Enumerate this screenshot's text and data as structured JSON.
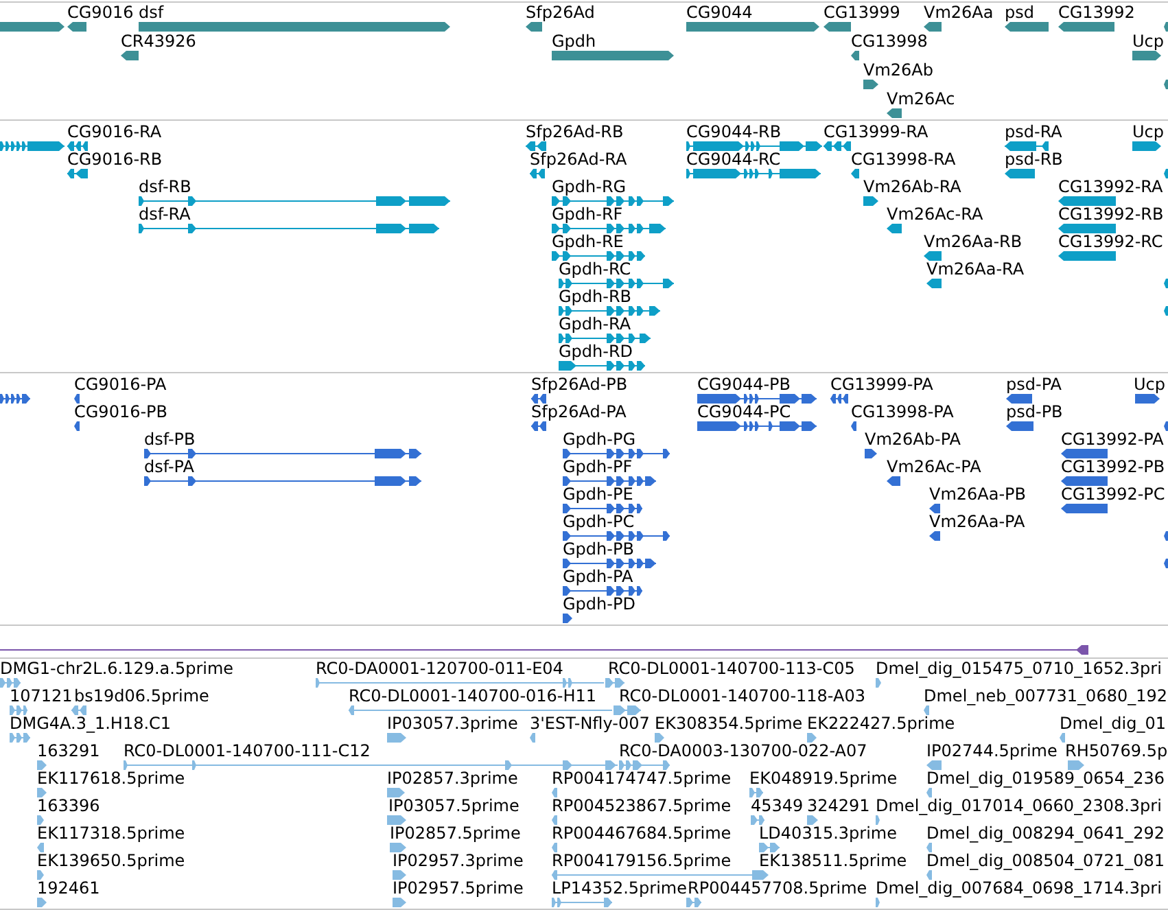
{
  "tracks": [
    {
      "color": "#3d9096",
      "rows": [
        {
          "features": [
            {
              "reverse": false
            },
            {
              "label": "CG9016",
              "reverse": true
            },
            {
              "label": "dsf",
              "reverse": false
            },
            {
              "label": "Sfp26Ad",
              "reverse": true
            },
            {
              "label": "CG9044",
              "reverse": false
            },
            {
              "label": "CG13999",
              "reverse": true
            },
            {
              "label": "Vm26Aa",
              "reverse": true
            },
            {
              "label": "psd",
              "reverse": true
            },
            {
              "label": "CG13992",
              "reverse": true
            },
            {
              "reverse": true
            }
          ]
        },
        {
          "features": [
            {
              "label": "CR43926",
              "reverse": true
            },
            {
              "label": "Gpdh",
              "reverse": false
            },
            {
              "label": "CG13998",
              "reverse": true
            },
            {
              "label": "Ucp",
              "reverse": false
            }
          ]
        },
        {
          "features": [
            {
              "label": "Vm26Ab",
              "reverse": false
            },
            {
              "reverse": true
            }
          ]
        },
        {
          "features": [
            {
              "label": "Vm26Ac",
              "reverse": true
            }
          ]
        }
      ]
    },
    {
      "color": "#0e9fc7",
      "rows": [
        {
          "features": [
            {
              "reverse": false
            },
            {
              "label": "CG9016-RA",
              "reverse": true
            },
            {
              "label": "Sfp26Ad-RB",
              "reverse": true
            },
            {
              "label": "CG9044-RB",
              "reverse": false
            },
            {
              "label": "CG13999-RA",
              "reverse": true
            },
            {
              "label": "psd-RA",
              "reverse": true
            },
            {
              "label": "Ucp",
              "reverse": false
            }
          ]
        },
        {
          "features": [
            {
              "label": "CG9016-RB",
              "reverse": true
            },
            {
              "label": "Sfp26Ad-RA",
              "reverse": true
            },
            {
              "label": "CG9044-RC",
              "reverse": false
            },
            {
              "label": "CG13998-RA",
              "reverse": true
            },
            {
              "label": "psd-RB",
              "reverse": true
            },
            {
              "reverse": true
            }
          ]
        },
        {
          "features": [
            {
              "label": "dsf-RB",
              "reverse": false
            },
            {
              "label": "Gpdh-RG",
              "reverse": false
            },
            {
              "label": "Vm26Ab-RA",
              "reverse": false
            },
            {
              "label": "CG13992-RA",
              "reverse": true
            }
          ]
        },
        {
          "features": [
            {
              "label": "dsf-RA",
              "reverse": false
            },
            {
              "label": "Gpdh-RF",
              "reverse": false
            },
            {
              "label": "Vm26Ac-RA",
              "reverse": true
            },
            {
              "label": "CG13992-RB",
              "reverse": true
            }
          ]
        },
        {
          "features": [
            {
              "label": "Gpdh-RE",
              "reverse": false
            },
            {
              "label": "Vm26Aa-RB",
              "reverse": true
            },
            {
              "label": "CG13992-RC",
              "reverse": true
            }
          ]
        },
        {
          "features": [
            {
              "label": "Gpdh-RC",
              "reverse": false
            },
            {
              "label": "Vm26Aa-RA",
              "reverse": true
            },
            {
              "reverse": true
            }
          ]
        },
        {
          "features": [
            {
              "label": "Gpdh-RB",
              "reverse": false
            },
            {
              "reverse": true
            }
          ]
        },
        {
          "features": [
            {
              "label": "Gpdh-RA",
              "reverse": false
            }
          ]
        },
        {
          "features": [
            {
              "label": "Gpdh-RD",
              "reverse": false
            }
          ]
        }
      ]
    },
    {
      "color": "#3370d4",
      "rows": [
        {
          "features": [
            {
              "reverse": false
            },
            {
              "label": "CG9016-PA",
              "reverse": true
            },
            {
              "label": "Sfp26Ad-PB",
              "reverse": true
            },
            {
              "label": "CG9044-PB",
              "reverse": false
            },
            {
              "label": "CG13999-PA",
              "reverse": true
            },
            {
              "label": "psd-PA",
              "reverse": true
            },
            {
              "label": "Ucp",
              "reverse": false
            }
          ]
        },
        {
          "features": [
            {
              "label": "CG9016-PB",
              "reverse": true
            },
            {
              "label": "Sfp26Ad-PA",
              "reverse": true
            },
            {
              "label": "CG9044-PC",
              "reverse": false
            },
            {
              "label": "CG13998-PA",
              "reverse": true
            },
            {
              "label": "psd-PB",
              "reverse": true
            },
            {
              "reverse": true
            }
          ]
        },
        {
          "features": [
            {
              "label": "dsf-PB",
              "reverse": false
            },
            {
              "label": "Gpdh-PG",
              "reverse": false
            },
            {
              "label": "Vm26Ab-PA",
              "reverse": false
            },
            {
              "label": "CG13992-PA",
              "reverse": true
            }
          ]
        },
        {
          "features": [
            {
              "label": "dsf-PA",
              "reverse": false
            },
            {
              "label": "Gpdh-PF",
              "reverse": false
            },
            {
              "label": "Vm26Ac-PA",
              "reverse": true
            },
            {
              "label": "CG13992-PB",
              "reverse": true
            }
          ]
        },
        {
          "features": [
            {
              "label": "Gpdh-PE",
              "reverse": false
            },
            {
              "label": "Vm26Aa-PB",
              "reverse": true
            },
            {
              "label": "CG13992-PC",
              "reverse": true
            }
          ]
        },
        {
          "features": [
            {
              "label": "Gpdh-PC",
              "reverse": false
            },
            {
              "label": "Vm26Aa-PA",
              "reverse": true
            },
            {
              "reverse": true
            }
          ]
        },
        {
          "features": [
            {
              "label": "Gpdh-PB",
              "reverse": false
            },
            {
              "reverse": true
            }
          ]
        },
        {
          "features": [
            {
              "label": "Gpdh-PA",
              "reverse": false
            }
          ]
        },
        {
          "features": [
            {
              "label": "Gpdh-PD",
              "reverse": false
            }
          ]
        }
      ]
    },
    {
      "color": "#7b55ab",
      "rows": [
        {
          "features": [
            {
              "reverse": true
            }
          ]
        }
      ]
    },
    {
      "color": "#86bbe2",
      "rows": [
        {
          "features": [
            {
              "label": "DMG1-chr2L.6.129.a.5prime",
              "reverse": false
            },
            {
              "label": "RC0-DA0001-120700-011-E04",
              "reverse": false
            },
            {
              "label": "RC0-DL0001-140700-113-C05",
              "reverse": false
            },
            {
              "label": "Dmel_dig_015475_0710_1652.3pri",
              "reverse": false
            }
          ]
        },
        {
          "features": [
            {
              "label": "107121",
              "reverse": false
            },
            {
              "label": "bs19d06.5prime",
              "reverse": true
            },
            {
              "label": "RC0-DL0001-140700-016-H11",
              "reverse": true
            },
            {
              "label": "RC0-DL0001-140700-118-A03",
              "reverse": false
            },
            {
              "label": "Dmel_neb_007731_0680_192",
              "reverse": true
            }
          ]
        },
        {
          "features": [
            {
              "label": "DMG4A.3_1.H18.C1",
              "reverse": false
            },
            {
              "label": "IP03057.3prime",
              "reverse": false
            },
            {
              "label": "3'EST-Nfly-007",
              "reverse": true
            },
            {
              "label": "EK308354.5prime",
              "reverse": false
            },
            {
              "label": "EK222427.5prime",
              "reverse": false
            },
            {
              "label": "Dmel_dig_01",
              "reverse": true
            }
          ]
        },
        {
          "features": [
            {
              "label": "163291",
              "reverse": false
            },
            {
              "label": "RC0-DL0001-140700-111-C12",
              "reverse": false
            },
            {
              "label": "RC0-DA0003-130700-022-A07",
              "reverse": false
            },
            {
              "label": "IP02744.5prime",
              "reverse": true
            },
            {
              "label": "RH50769.5p",
              "reverse": false
            }
          ]
        },
        {
          "features": [
            {
              "label": "EK117618.5prime",
              "reverse": false
            },
            {
              "label": "IP02857.3prime",
              "reverse": false
            },
            {
              "label": "RP004174747.5prime",
              "reverse": true
            },
            {
              "label": "EK048919.5prime",
              "reverse": false
            },
            {
              "label": "Dmel_dig_019589_0654_236",
              "reverse": true
            }
          ]
        },
        {
          "features": [
            {
              "label": "163396",
              "reverse": false
            },
            {
              "label": "IP03057.5prime",
              "reverse": false
            },
            {
              "label": "RP004523867.5prime",
              "reverse": true
            },
            {
              "label": "45349",
              "reverse": false
            },
            {
              "label": "324291",
              "reverse": false
            },
            {
              "label": "Dmel_dig_017014_0660_2308.3pri",
              "reverse": false
            }
          ]
        },
        {
          "features": [
            {
              "label": "EK117318.5prime",
              "reverse": true
            },
            {
              "label": "IP02857.5prime",
              "reverse": false
            },
            {
              "label": "RP004467684.5prime",
              "reverse": true
            },
            {
              "label": "LD40315.3prime",
              "reverse": false
            },
            {
              "label": "Dmel_dig_008294_0641_292",
              "reverse": true
            }
          ]
        },
        {
          "features": [
            {
              "label": "EK139650.5prime",
              "reverse": false
            },
            {
              "label": "IP02957.3prime",
              "reverse": false
            },
            {
              "label": "RP004179156.5prime",
              "reverse": true
            },
            {
              "label": "EK138511.5prime",
              "reverse": false
            },
            {
              "label": "Dmel_dig_008504_0721_081",
              "reverse": true
            }
          ]
        },
        {
          "features": [
            {
              "label": "192461",
              "reverse": false
            },
            {
              "label": "IP02957.5prime",
              "reverse": false
            },
            {
              "label": "LP14352.5prime",
              "reverse": false
            },
            {
              "label": "RP004457708.5prime",
              "reverse": false
            },
            {
              "label": "Dmel_dig_007684_0698_1714.3pri",
              "reverse": false
            }
          ]
        }
      ]
    }
  ]
}
